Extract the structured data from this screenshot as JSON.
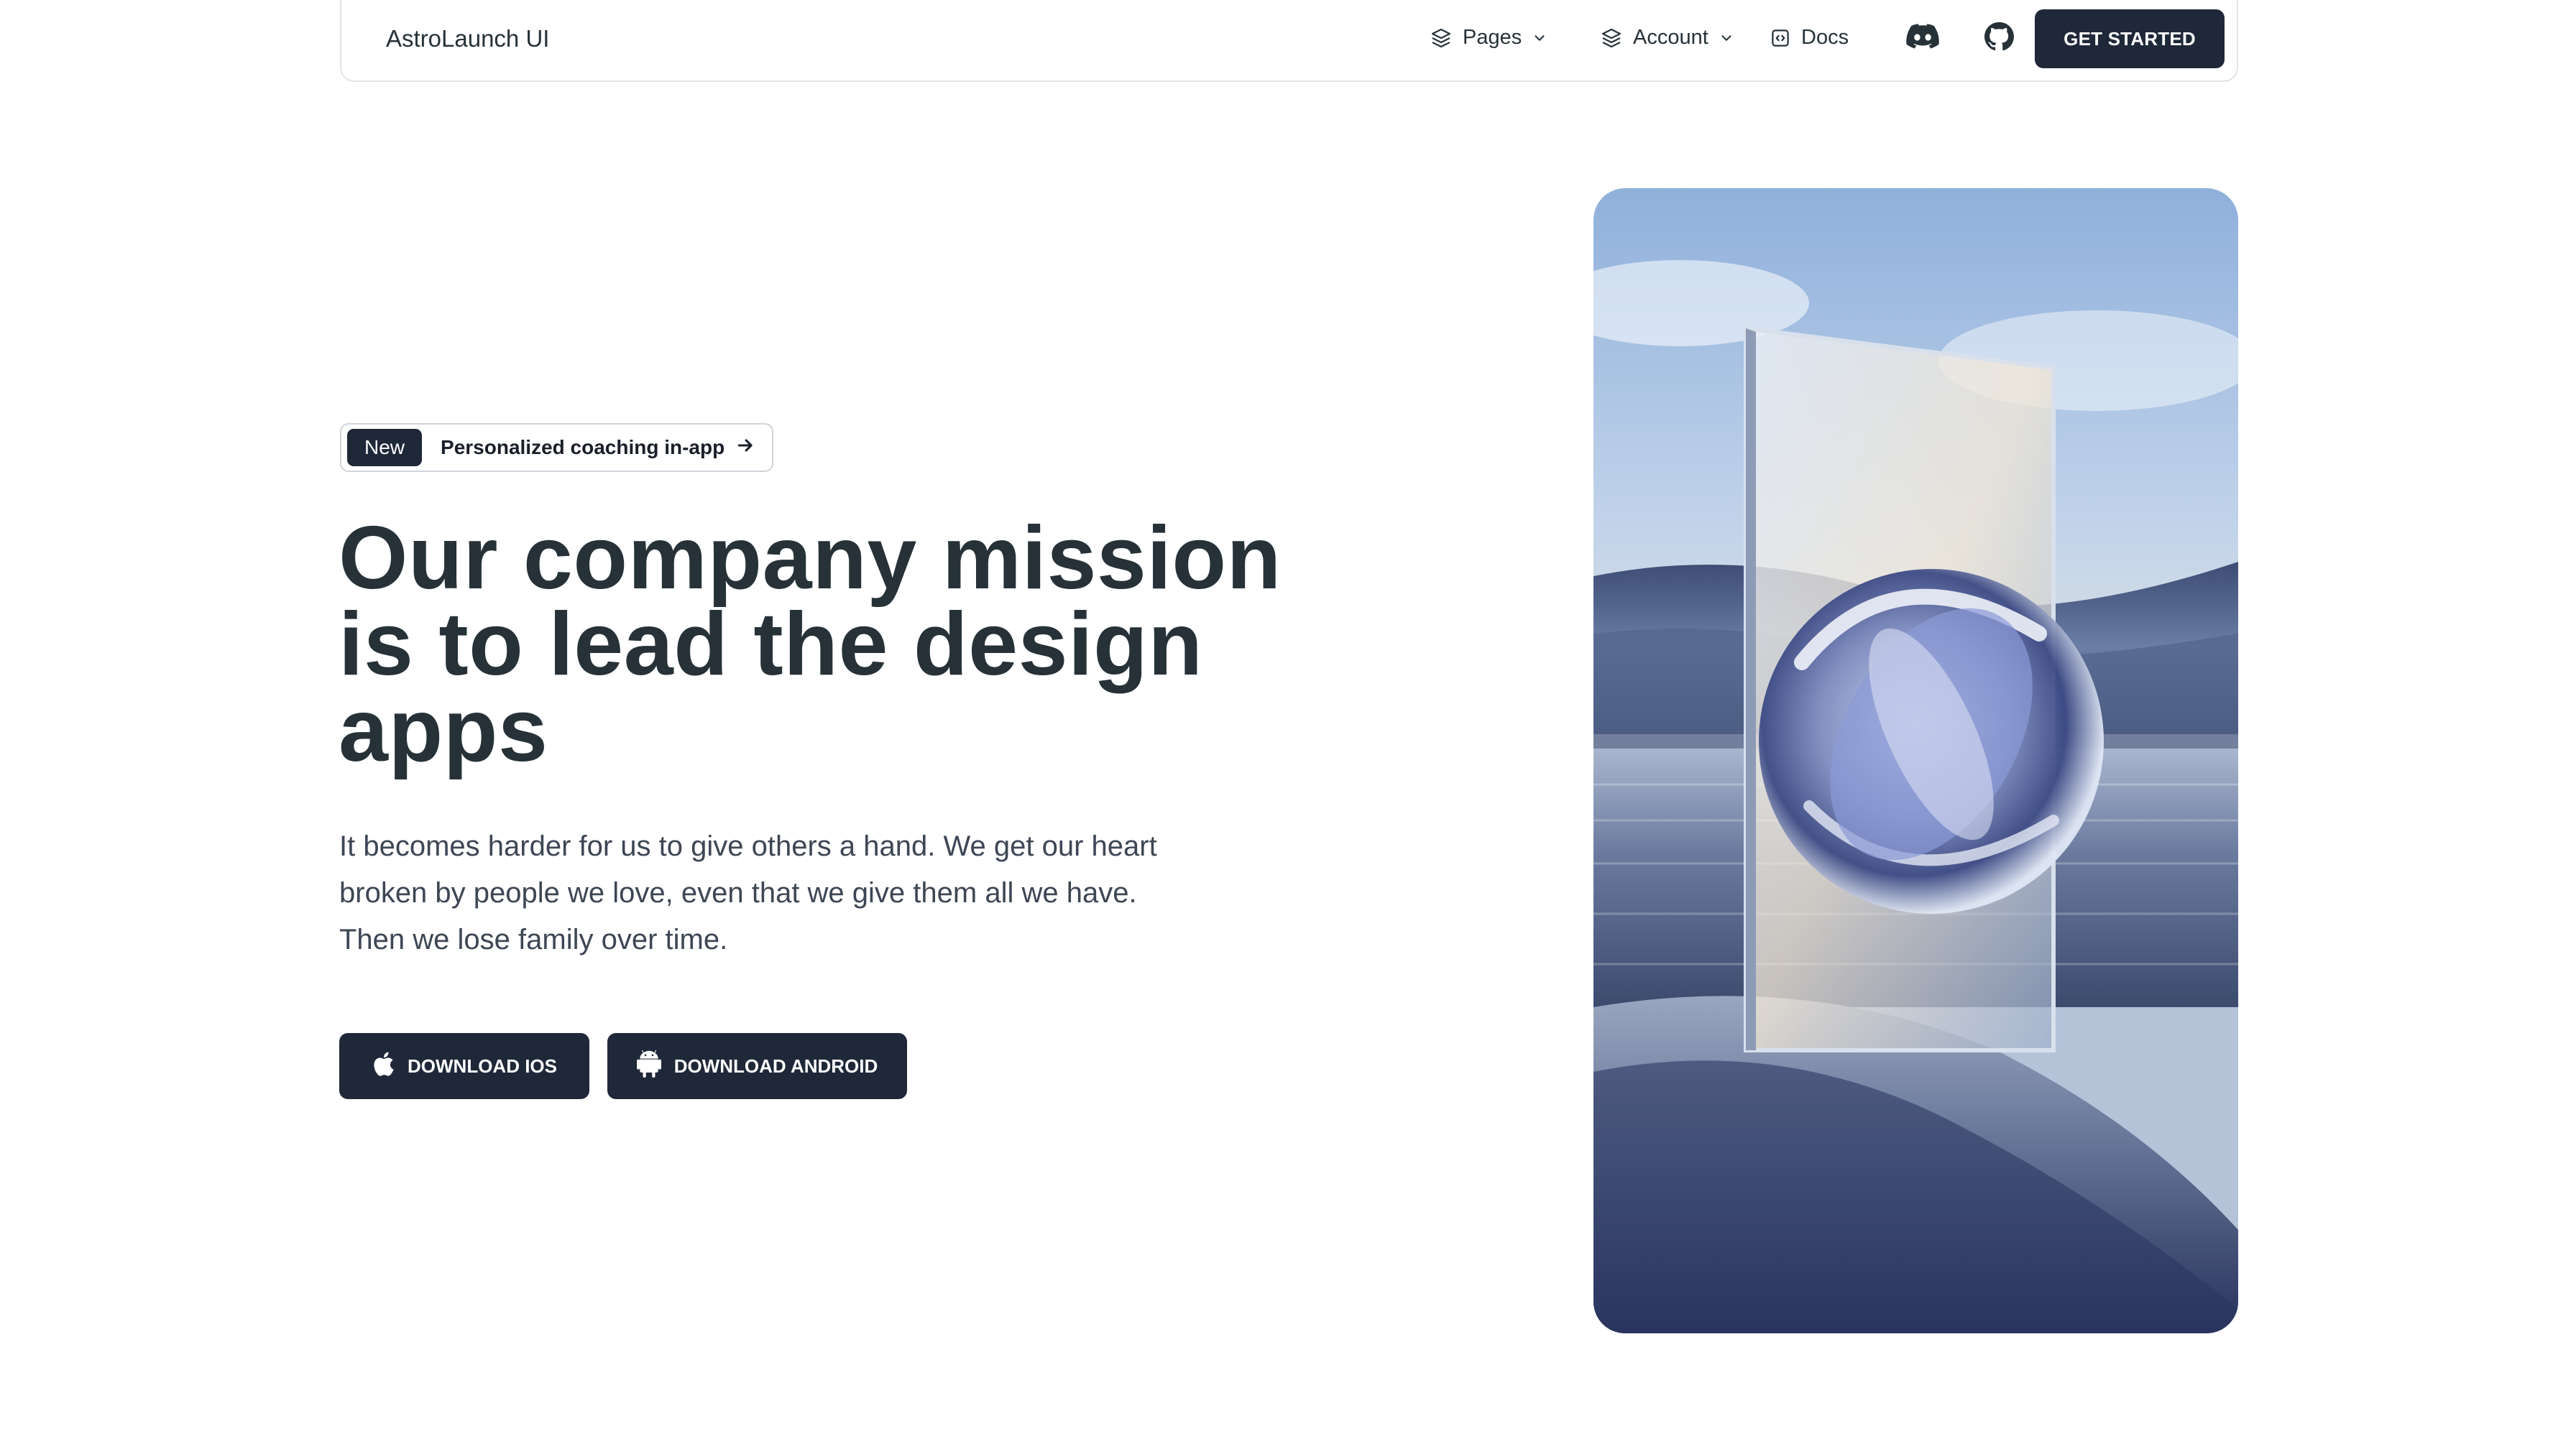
{
  "navbar": {
    "brand": "AstroLaunch UI",
    "items": [
      {
        "label": "Pages",
        "icon": "stack-icon",
        "has_dropdown": true
      },
      {
        "label": "Account",
        "icon": "stack-icon",
        "has_dropdown": true
      },
      {
        "label": "Docs",
        "icon": "code-box-icon",
        "has_dropdown": false
      }
    ],
    "social": [
      "discord-icon",
      "github-icon"
    ],
    "cta_label": "GET STARTED"
  },
  "hero": {
    "badge": {
      "pill": "New",
      "text": "Personalized coaching in-app",
      "icon": "arrow-right-icon"
    },
    "title_lines": [
      "Our company mission",
      "is to lead the design",
      "apps"
    ],
    "description_lines": [
      "It becomes harder for us to give others a hand. We get our heart",
      "broken by people we love, even that we give them all we have.",
      "Then we lose family over time."
    ],
    "buttons": [
      {
        "label": "DOWNLOAD IOS",
        "icon": "apple-icon"
      },
      {
        "label": "DOWNLOAD ANDROID",
        "icon": "android-icon"
      }
    ]
  },
  "colors": {
    "primary": "#1f2838",
    "text": "#263238",
    "muted_text": "#3d4654",
    "border": "#e2e4e8"
  }
}
